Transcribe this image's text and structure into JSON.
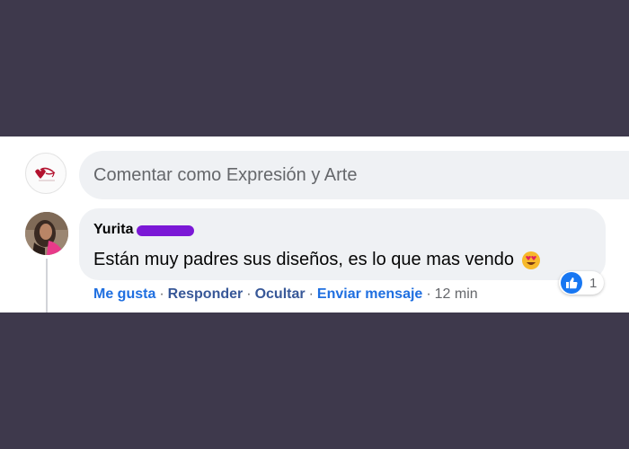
{
  "composer": {
    "placeholder": "Comentar como Expresión y Arte",
    "page_avatar_icon": "page-logo-avatar"
  },
  "comment": {
    "author": "Yurita",
    "author_surname_redacted": true,
    "text": "Están muy padres sus diseños, es lo que mas vendo",
    "emoji": "heart-eyes-emoji",
    "reactions": {
      "icon": "like-icon",
      "count": "1"
    },
    "actions": {
      "like": "Me gusta",
      "reply": "Responder",
      "hide": "Ocultar",
      "send_message": "Enviar mensaje",
      "time": "12 min"
    }
  },
  "colors": {
    "background": "#3e394c",
    "bubble": "#eff1f4",
    "link": "#385898",
    "accent": "#1877f2",
    "redaction": "#7b18d6"
  }
}
